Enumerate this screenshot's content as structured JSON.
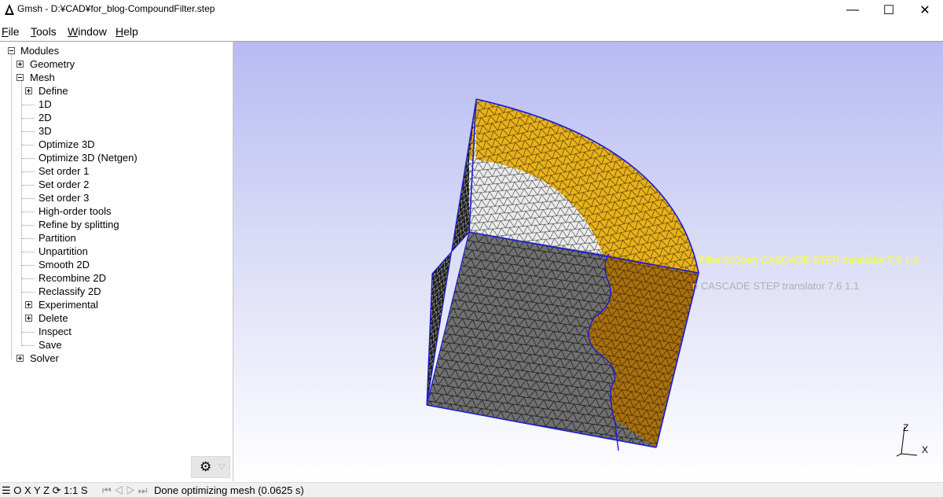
{
  "window": {
    "title": "Gmsh - D:¥CAD¥for_blog-CompoundFilter.step",
    "minimize": "—",
    "maximize": "☐",
    "close": "✕"
  },
  "menu": [
    {
      "underline": "F",
      "rest": "ile"
    },
    {
      "underline": "T",
      "rest": "ools"
    },
    {
      "underline": "W",
      "rest": "indow"
    },
    {
      "underline": "H",
      "rest": "elp"
    }
  ],
  "tree": {
    "modules": "Modules",
    "geometry": "Geometry",
    "mesh": "Mesh",
    "mesh_items": [
      "Define",
      "1D",
      "2D",
      "3D",
      "Optimize 3D",
      "Optimize 3D (Netgen)",
      "Set order 1",
      "Set order 2",
      "Set order 3",
      "High-order tools",
      "Refine by splitting",
      "Partition",
      "Unpartition",
      "Smooth 2D",
      "Recombine 2D",
      "Reclassify 2D",
      "Experimental",
      "Delete",
      "Inspect",
      "Save"
    ],
    "solver": "Solver"
  },
  "options_button": {
    "gear": "⚙",
    "arrow": "▽"
  },
  "viewport": {
    "overlay_line1": "Filter/2/Open CASCADE STEP translator 7.6 1.2",
    "overlay_line2": "n CASCADE STEP translator 7.6 1.1",
    "axis_z": "Z",
    "axis_x": "X"
  },
  "status": {
    "nav": "☰ O X Y Z ⟳ 1:1 S",
    "playback": "⏮ ◁ ▷ ⏭",
    "message": "Done optimizing mesh (0.0625 s)"
  },
  "colors": {
    "yellow_face": "#e8b21c",
    "brown_face": "#a8700e",
    "gray_face": "#6e6e6e",
    "light_face": "#e9e9e9",
    "dark_face": "#2a2a2a",
    "edge_blue": "#1b1bd8"
  }
}
